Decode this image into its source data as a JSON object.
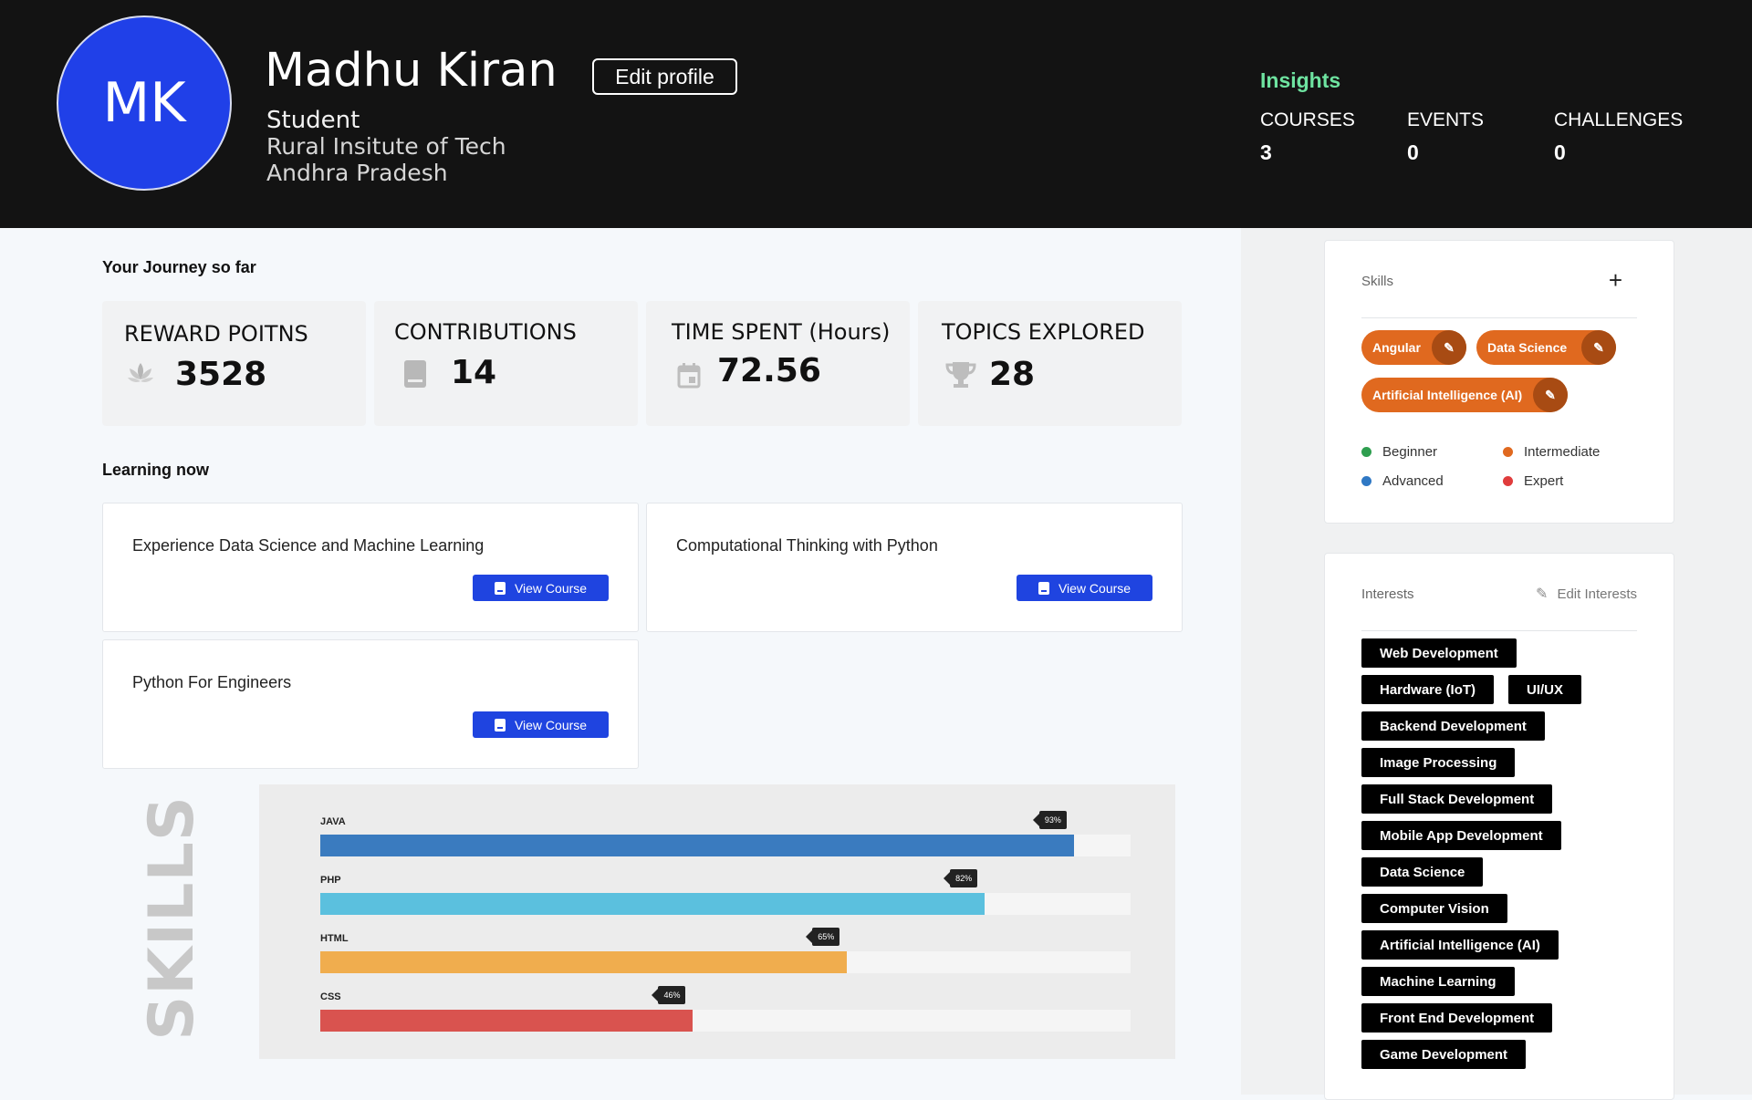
{
  "profile": {
    "initials": "MK",
    "name": "Madhu Kiran",
    "edit_label": "Edit profile",
    "role": "Student",
    "institute": "Rural Insitute of Tech",
    "state": "Andhra Pradesh"
  },
  "insights": {
    "title": "Insights",
    "stats": [
      {
        "label": "COURSES",
        "value": "3"
      },
      {
        "label": "EVENTS",
        "value": "0"
      },
      {
        "label": "CHALLENGES",
        "value": "0"
      }
    ]
  },
  "journey": {
    "title": "Your Journey so far",
    "metrics": [
      {
        "label": "REWARD POITNS",
        "value": "3528",
        "icon": "lotus-icon"
      },
      {
        "label": "CONTRIBUTIONS",
        "value": "14",
        "icon": "book-icon"
      },
      {
        "label": "TIME SPENT (Hours)",
        "value": "72.56",
        "icon": "calendar-icon"
      },
      {
        "label": "TOPICS EXPLORED",
        "value": "28",
        "icon": "trophy-icon"
      }
    ]
  },
  "learning": {
    "title": "Learning now",
    "view_label": "View Course",
    "courses": [
      {
        "title": "Experience Data Science and Machine Learning"
      },
      {
        "title": "Computational Thinking with Python"
      },
      {
        "title": "Python For Engineers"
      }
    ]
  },
  "skills_chart": {
    "title": "SKILLS",
    "bars": [
      {
        "name": "JAVA",
        "percent": 93,
        "label": "93%",
        "color": "#3a7bbf"
      },
      {
        "name": "PHP",
        "percent": 82,
        "label": "82%",
        "color": "#5bc0de"
      },
      {
        "name": "HTML",
        "percent": 65,
        "label": "65%",
        "color": "#f0ad4e"
      },
      {
        "name": "CSS",
        "percent": 46,
        "label": "46%",
        "color": "#d9534f"
      }
    ]
  },
  "skills_card": {
    "title": "Skills",
    "add_symbol": "+",
    "chips": [
      {
        "label": "Angular"
      },
      {
        "label": "Data Science"
      },
      {
        "label": "Artificial Intelligence (AI)"
      }
    ],
    "chip_color": "#e0691f",
    "legend": [
      {
        "label": "Beginner",
        "color": "#2e9e4f"
      },
      {
        "label": "Intermediate",
        "color": "#e0691f"
      },
      {
        "label": "Advanced",
        "color": "#2f78c4"
      },
      {
        "label": "Expert",
        "color": "#e03c3c"
      }
    ]
  },
  "interests_card": {
    "title": "Interests",
    "edit_label": "Edit Interests",
    "items": [
      "Web Development",
      "Hardware (IoT)",
      "UI/UX",
      "Backend Development",
      "Image Processing",
      "Full Stack Development",
      "Mobile App Development",
      "Data Science",
      "Computer Vision",
      "Artificial Intelligence (AI)",
      "Machine Learning",
      "Front End Development",
      "Game Development"
    ]
  }
}
